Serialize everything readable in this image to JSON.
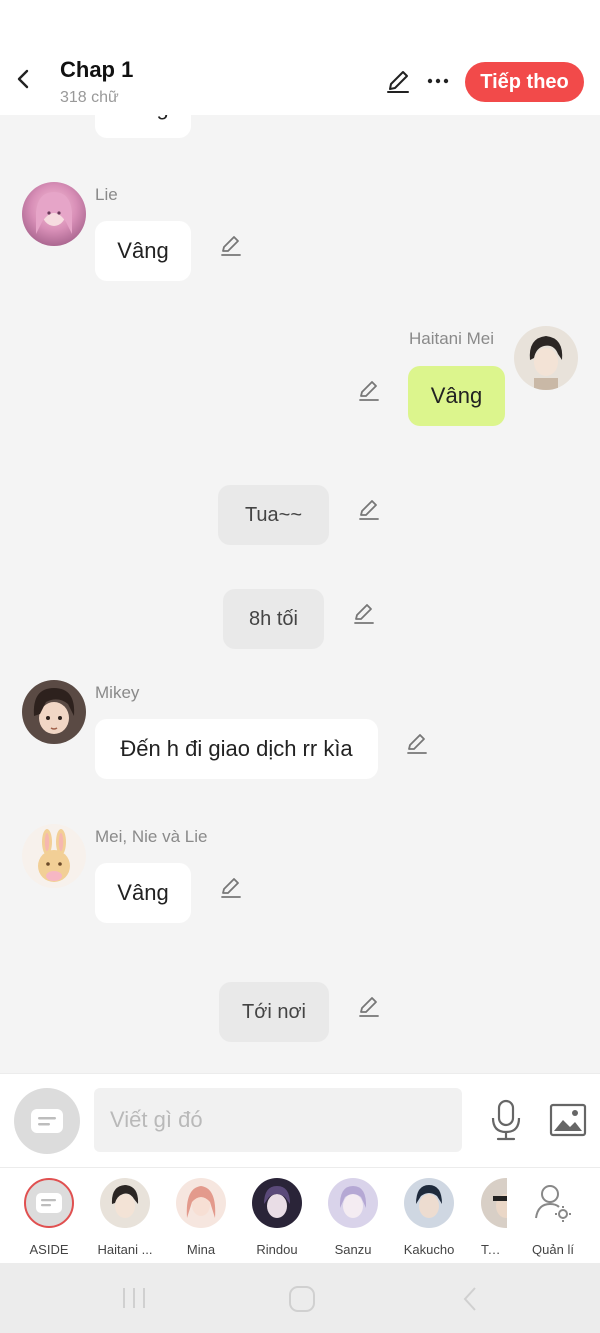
{
  "header": {
    "title": "Chap 1",
    "subtitle": "318 chữ",
    "next_label": "Tiếp theo",
    "accent_color": "#f24a4a"
  },
  "messages": [
    {
      "type": "other",
      "sender": "",
      "text": "Vâng",
      "avatar_icon": ""
    },
    {
      "type": "other",
      "sender": "Lie",
      "text": "Vâng",
      "avatar_icon": "pink-hair-girl-avatar"
    },
    {
      "type": "mine",
      "sender": "Haitani Mei",
      "text": "Vâng",
      "avatar_icon": "dark-hair-boy-avatar"
    },
    {
      "type": "narration",
      "text": "Tua~~"
    },
    {
      "type": "narration",
      "text": "8h tối"
    },
    {
      "type": "other",
      "sender": "Mikey",
      "text": "Đến h đi giao dịch rr kìa",
      "avatar_icon": "mikey-avatar"
    },
    {
      "type": "other",
      "sender": "Mei, Nie và Lie",
      "text": "Vâng",
      "avatar_icon": "bunny-avatar"
    },
    {
      "type": "narration",
      "text": "Tới nơi"
    }
  ],
  "composer": {
    "placeholder": "Viết gì đó"
  },
  "characters": [
    {
      "name": "ASIDE",
      "icon": "aside-icon"
    },
    {
      "name": "Haitani ...",
      "icon": "haitani-avatar"
    },
    {
      "name": "Mina",
      "icon": "mina-avatar"
    },
    {
      "name": "Rindou",
      "icon": "rindou-avatar"
    },
    {
      "name": "Sanzu",
      "icon": "sanzu-avatar"
    },
    {
      "name": "Kakucho",
      "icon": "kakucho-avatar"
    },
    {
      "name": "Take",
      "icon": "take-avatar"
    },
    {
      "name": "Quản lí",
      "icon": "manage-users-icon"
    }
  ],
  "colors": {
    "my_bubble": "#dcf58d",
    "narration_bubble": "#e9e9e9",
    "background": "#f4f4f4"
  }
}
